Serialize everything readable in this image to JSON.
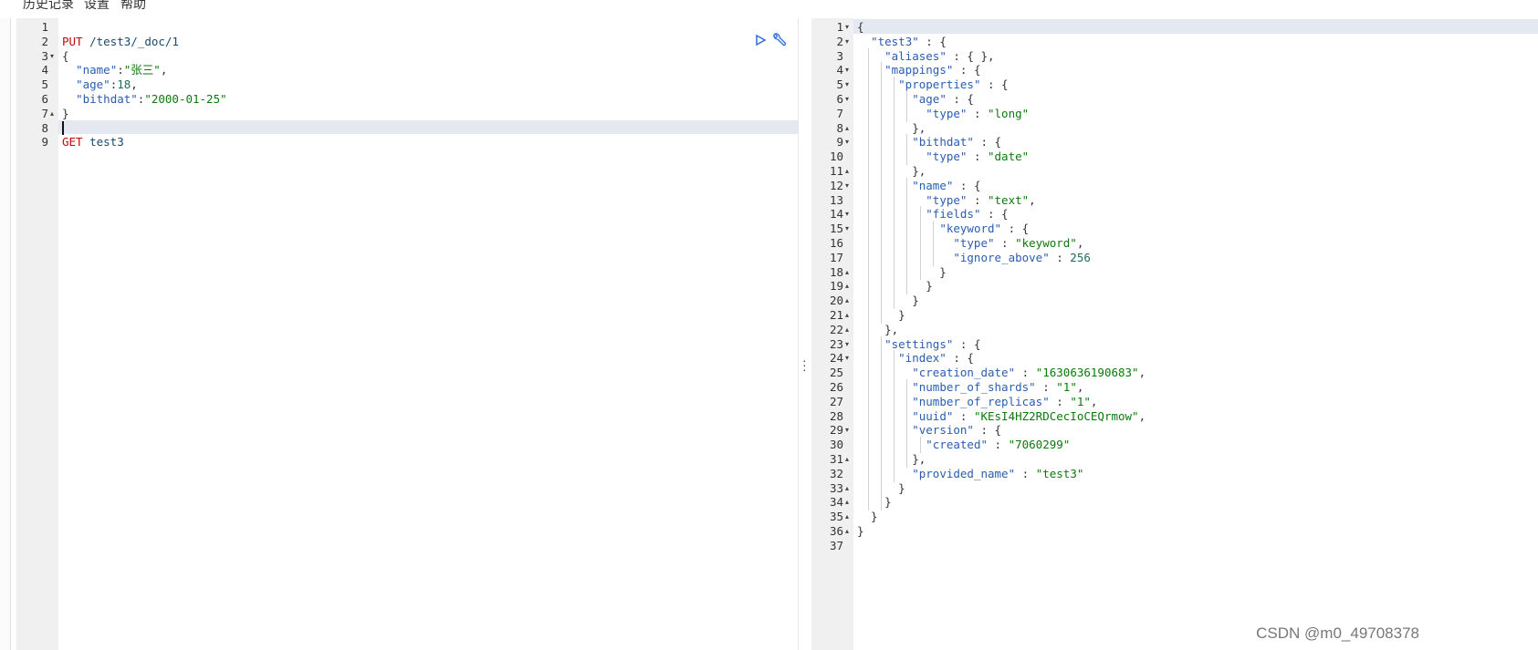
{
  "menu": {
    "items": [
      "历史记录",
      "设置",
      "帮助"
    ]
  },
  "request_editor": {
    "lines": [
      {
        "num": "1",
        "fold": "",
        "tokens": []
      },
      {
        "num": "2",
        "fold": "",
        "tokens": [
          {
            "t": "PUT ",
            "c": "k"
          },
          {
            "t": "/test3/_doc/1",
            "c": "u"
          }
        ]
      },
      {
        "num": "3",
        "fold": "▾",
        "tokens": [
          {
            "t": "{",
            "c": "pl"
          }
        ]
      },
      {
        "num": "4",
        "fold": "",
        "tokens": [
          {
            "t": "  ",
            "c": "pl"
          },
          {
            "t": "\"name\"",
            "c": "p"
          },
          {
            "t": ":",
            "c": "pl"
          },
          {
            "t": "\"张三\"",
            "c": "s"
          },
          {
            "t": ",",
            "c": "pl"
          }
        ]
      },
      {
        "num": "5",
        "fold": "",
        "tokens": [
          {
            "t": "  ",
            "c": "pl"
          },
          {
            "t": "\"age\"",
            "c": "p"
          },
          {
            "t": ":",
            "c": "pl"
          },
          {
            "t": "18",
            "c": "n"
          },
          {
            "t": ",",
            "c": "pl"
          }
        ]
      },
      {
        "num": "6",
        "fold": "",
        "tokens": [
          {
            "t": "  ",
            "c": "pl"
          },
          {
            "t": "\"bithdat\"",
            "c": "p"
          },
          {
            "t": ":",
            "c": "pl"
          },
          {
            "t": "\"2000-01-25\"",
            "c": "s"
          }
        ]
      },
      {
        "num": "7",
        "fold": "▴",
        "tokens": [
          {
            "t": "}",
            "c": "pl"
          }
        ]
      },
      {
        "num": "8",
        "fold": "",
        "tokens": [],
        "active": true
      },
      {
        "num": "9",
        "fold": "",
        "tokens": [
          {
            "t": "GET ",
            "c": "k"
          },
          {
            "t": "test3",
            "c": "u"
          }
        ]
      }
    ]
  },
  "response_editor": {
    "lines": [
      {
        "num": "1",
        "fold": "▾",
        "tokens": [
          {
            "t": "{",
            "c": "pl"
          }
        ],
        "active": true
      },
      {
        "num": "2",
        "fold": "▾",
        "tokens": [
          {
            "t": "  ",
            "c": "pl"
          },
          {
            "t": "\"test3\"",
            "c": "p"
          },
          {
            "t": " : {",
            "c": "pl"
          }
        ]
      },
      {
        "num": "3",
        "fold": "",
        "tokens": [
          {
            "t": "    ",
            "c": "pl"
          },
          {
            "t": "\"aliases\"",
            "c": "p"
          },
          {
            "t": " : { },",
            "c": "pl"
          }
        ]
      },
      {
        "num": "4",
        "fold": "▾",
        "tokens": [
          {
            "t": "    ",
            "c": "pl"
          },
          {
            "t": "\"mappings\"",
            "c": "p"
          },
          {
            "t": " : {",
            "c": "pl"
          }
        ]
      },
      {
        "num": "5",
        "fold": "▾",
        "tokens": [
          {
            "t": "      ",
            "c": "pl"
          },
          {
            "t": "\"properties\"",
            "c": "p"
          },
          {
            "t": " : {",
            "c": "pl"
          }
        ]
      },
      {
        "num": "6",
        "fold": "▾",
        "tokens": [
          {
            "t": "        ",
            "c": "pl"
          },
          {
            "t": "\"age\"",
            "c": "p"
          },
          {
            "t": " : {",
            "c": "pl"
          }
        ]
      },
      {
        "num": "7",
        "fold": "",
        "tokens": [
          {
            "t": "          ",
            "c": "pl"
          },
          {
            "t": "\"type\"",
            "c": "p"
          },
          {
            "t": " : ",
            "c": "pl"
          },
          {
            "t": "\"long\"",
            "c": "s"
          }
        ]
      },
      {
        "num": "8",
        "fold": "▴",
        "tokens": [
          {
            "t": "        },",
            "c": "pl"
          }
        ]
      },
      {
        "num": "9",
        "fold": "▾",
        "tokens": [
          {
            "t": "        ",
            "c": "pl"
          },
          {
            "t": "\"bithdat\"",
            "c": "p"
          },
          {
            "t": " : {",
            "c": "pl"
          }
        ]
      },
      {
        "num": "10",
        "fold": "",
        "tokens": [
          {
            "t": "          ",
            "c": "pl"
          },
          {
            "t": "\"type\"",
            "c": "p"
          },
          {
            "t": " : ",
            "c": "pl"
          },
          {
            "t": "\"date\"",
            "c": "s"
          }
        ]
      },
      {
        "num": "11",
        "fold": "▴",
        "tokens": [
          {
            "t": "        },",
            "c": "pl"
          }
        ]
      },
      {
        "num": "12",
        "fold": "▾",
        "tokens": [
          {
            "t": "        ",
            "c": "pl"
          },
          {
            "t": "\"name\"",
            "c": "p"
          },
          {
            "t": " : {",
            "c": "pl"
          }
        ]
      },
      {
        "num": "13",
        "fold": "",
        "tokens": [
          {
            "t": "          ",
            "c": "pl"
          },
          {
            "t": "\"type\"",
            "c": "p"
          },
          {
            "t": " : ",
            "c": "pl"
          },
          {
            "t": "\"text\"",
            "c": "s"
          },
          {
            "t": ",",
            "c": "pl"
          }
        ]
      },
      {
        "num": "14",
        "fold": "▾",
        "tokens": [
          {
            "t": "          ",
            "c": "pl"
          },
          {
            "t": "\"fields\"",
            "c": "p"
          },
          {
            "t": " : {",
            "c": "pl"
          }
        ]
      },
      {
        "num": "15",
        "fold": "▾",
        "tokens": [
          {
            "t": "            ",
            "c": "pl"
          },
          {
            "t": "\"keyword\"",
            "c": "p"
          },
          {
            "t": " : {",
            "c": "pl"
          }
        ]
      },
      {
        "num": "16",
        "fold": "",
        "tokens": [
          {
            "t": "              ",
            "c": "pl"
          },
          {
            "t": "\"type\"",
            "c": "p"
          },
          {
            "t": " : ",
            "c": "pl"
          },
          {
            "t": "\"keyword\"",
            "c": "s"
          },
          {
            "t": ",",
            "c": "pl"
          }
        ]
      },
      {
        "num": "17",
        "fold": "",
        "tokens": [
          {
            "t": "              ",
            "c": "pl"
          },
          {
            "t": "\"ignore_above\"",
            "c": "p"
          },
          {
            "t": " : ",
            "c": "pl"
          },
          {
            "t": "256",
            "c": "n"
          }
        ]
      },
      {
        "num": "18",
        "fold": "▴",
        "tokens": [
          {
            "t": "            }",
            "c": "pl"
          }
        ]
      },
      {
        "num": "19",
        "fold": "▴",
        "tokens": [
          {
            "t": "          }",
            "c": "pl"
          }
        ]
      },
      {
        "num": "20",
        "fold": "▴",
        "tokens": [
          {
            "t": "        }",
            "c": "pl"
          }
        ]
      },
      {
        "num": "21",
        "fold": "▴",
        "tokens": [
          {
            "t": "      }",
            "c": "pl"
          }
        ]
      },
      {
        "num": "22",
        "fold": "▴",
        "tokens": [
          {
            "t": "    },",
            "c": "pl"
          }
        ]
      },
      {
        "num": "23",
        "fold": "▾",
        "tokens": [
          {
            "t": "    ",
            "c": "pl"
          },
          {
            "t": "\"settings\"",
            "c": "p"
          },
          {
            "t": " : {",
            "c": "pl"
          }
        ]
      },
      {
        "num": "24",
        "fold": "▾",
        "tokens": [
          {
            "t": "      ",
            "c": "pl"
          },
          {
            "t": "\"index\"",
            "c": "p"
          },
          {
            "t": " : {",
            "c": "pl"
          }
        ]
      },
      {
        "num": "25",
        "fold": "",
        "tokens": [
          {
            "t": "        ",
            "c": "pl"
          },
          {
            "t": "\"creation_date\"",
            "c": "p"
          },
          {
            "t": " : ",
            "c": "pl"
          },
          {
            "t": "\"1630636190683\"",
            "c": "s"
          },
          {
            "t": ",",
            "c": "pl"
          }
        ]
      },
      {
        "num": "26",
        "fold": "",
        "tokens": [
          {
            "t": "        ",
            "c": "pl"
          },
          {
            "t": "\"number_of_shards\"",
            "c": "p"
          },
          {
            "t": " : ",
            "c": "pl"
          },
          {
            "t": "\"1\"",
            "c": "s"
          },
          {
            "t": ",",
            "c": "pl"
          }
        ]
      },
      {
        "num": "27",
        "fold": "",
        "tokens": [
          {
            "t": "        ",
            "c": "pl"
          },
          {
            "t": "\"number_of_replicas\"",
            "c": "p"
          },
          {
            "t": " : ",
            "c": "pl"
          },
          {
            "t": "\"1\"",
            "c": "s"
          },
          {
            "t": ",",
            "c": "pl"
          }
        ]
      },
      {
        "num": "28",
        "fold": "",
        "tokens": [
          {
            "t": "        ",
            "c": "pl"
          },
          {
            "t": "\"uuid\"",
            "c": "p"
          },
          {
            "t": " : ",
            "c": "pl"
          },
          {
            "t": "\"KEsI4HZ2RDCecIoCEQrmow\"",
            "c": "s"
          },
          {
            "t": ",",
            "c": "pl"
          }
        ]
      },
      {
        "num": "29",
        "fold": "▾",
        "tokens": [
          {
            "t": "        ",
            "c": "pl"
          },
          {
            "t": "\"version\"",
            "c": "p"
          },
          {
            "t": " : {",
            "c": "pl"
          }
        ]
      },
      {
        "num": "30",
        "fold": "",
        "tokens": [
          {
            "t": "          ",
            "c": "pl"
          },
          {
            "t": "\"created\"",
            "c": "p"
          },
          {
            "t": " : ",
            "c": "pl"
          },
          {
            "t": "\"7060299\"",
            "c": "s"
          }
        ]
      },
      {
        "num": "31",
        "fold": "▴",
        "tokens": [
          {
            "t": "        },",
            "c": "pl"
          }
        ]
      },
      {
        "num": "32",
        "fold": "",
        "tokens": [
          {
            "t": "        ",
            "c": "pl"
          },
          {
            "t": "\"provided_name\"",
            "c": "p"
          },
          {
            "t": " : ",
            "c": "pl"
          },
          {
            "t": "\"test3\"",
            "c": "s"
          }
        ]
      },
      {
        "num": "33",
        "fold": "▴",
        "tokens": [
          {
            "t": "      }",
            "c": "pl"
          }
        ]
      },
      {
        "num": "34",
        "fold": "▴",
        "tokens": [
          {
            "t": "    }",
            "c": "pl"
          }
        ]
      },
      {
        "num": "35",
        "fold": "▴",
        "tokens": [
          {
            "t": "  }",
            "c": "pl"
          }
        ]
      },
      {
        "num": "36",
        "fold": "▴",
        "tokens": [
          {
            "t": "}",
            "c": "pl"
          }
        ]
      },
      {
        "num": "37",
        "fold": "",
        "tokens": []
      }
    ]
  },
  "icons": {
    "run": "play-triangle-icon",
    "settings": "wrench-icon",
    "splitter": "vertical-ellipsis-icon"
  },
  "watermark": "CSDN @m0_49708378",
  "colors": {
    "keyword": "#c5060b",
    "property": "#2a5db0",
    "string": "#0b7a0b",
    "number": "#1a6c5c",
    "active_line": "#e4e8f0",
    "gutter": "#f0f0f0",
    "run_icon": "#2b6fd6"
  }
}
